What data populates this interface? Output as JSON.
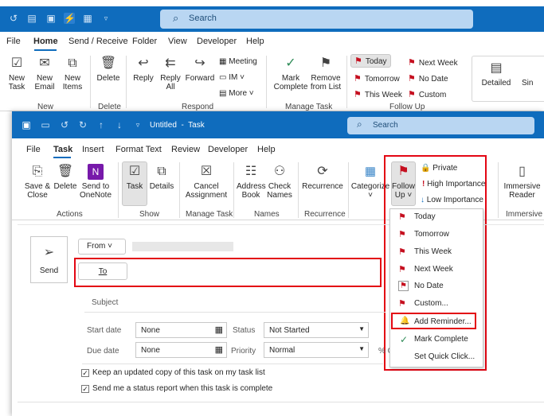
{
  "main_window": {
    "search": {
      "placeholder": "Search"
    },
    "menu": [
      "File",
      "Home",
      "Send / Receive",
      "Folder",
      "View",
      "Developer",
      "Help"
    ],
    "ribbon": {
      "new_task": "New\nTask",
      "new_email": "New\nEmail",
      "new_items": "New\nItems",
      "new_group": "New",
      "delete": "Delete",
      "delete_group": "Delete",
      "reply": "Reply",
      "reply_all": "Reply\nAll",
      "forward": "Forward",
      "meeting": "Meeting",
      "im": "IM",
      "more": "More",
      "respond_group": "Respond",
      "mark_complete": "Mark\nComplete",
      "remove_from_list": "Remove\nfrom List",
      "manage_task_group": "Manage Task",
      "today": "Today",
      "tomorrow": "Tomorrow",
      "this_week": "This Week",
      "next_week": "Next Week",
      "no_date": "No Date",
      "custom": "Custom",
      "follow_up_group": "Follow Up",
      "detailed": "Detailed",
      "simple": "Sin"
    }
  },
  "task_window": {
    "title": "Untitled  -  Task",
    "search": {
      "placeholder": "Search"
    },
    "menu": [
      "File",
      "Task",
      "Insert",
      "Format Text",
      "Review",
      "Developer",
      "Help"
    ],
    "ribbon": {
      "save_close": "Save &\nClose",
      "delete": "Delete",
      "send_onenote": "Send to\nOneNote",
      "actions_group": "Actions",
      "task": "Task",
      "details": "Details",
      "show_group": "Show",
      "cancel_assignment": "Cancel\nAssignment",
      "manage_task_group": "Manage Task",
      "address_book": "Address\nBook",
      "check_names": "Check\nNames",
      "names_group": "Names",
      "recurrence": "Recurrence",
      "recurrence_group": "Recurrence",
      "categorize": "Categorize",
      "follow_up": "Follow\nUp",
      "private": "Private",
      "high_importance": "High Importance",
      "low_importance": "Low Importance",
      "immersive_reader": "Immersive\nReader",
      "immersive_group": "Immersive"
    },
    "form": {
      "send": "Send",
      "from": "From",
      "to": "To",
      "subject": "Subject",
      "start_date_label": "Start date",
      "start_date_value": "None",
      "due_date_label": "Due date",
      "due_date_value": "None",
      "status_label": "Status",
      "status_value": "Not Started",
      "priority_label": "Priority",
      "priority_value": "Normal",
      "percent_label": "% C",
      "keep_copy": "Keep an updated copy of this task on my task list",
      "status_report": "Send me a status report when this task is complete"
    },
    "followup_menu": [
      "Today",
      "Tomorrow",
      "This Week",
      "Next Week",
      "No Date",
      "Custom...",
      "Add Reminder...",
      "Mark Complete",
      "Set Quick Click..."
    ]
  },
  "colors": {
    "accent": "#0f6cbd",
    "flag": "#c50f1f",
    "highlight": "#e30613"
  }
}
